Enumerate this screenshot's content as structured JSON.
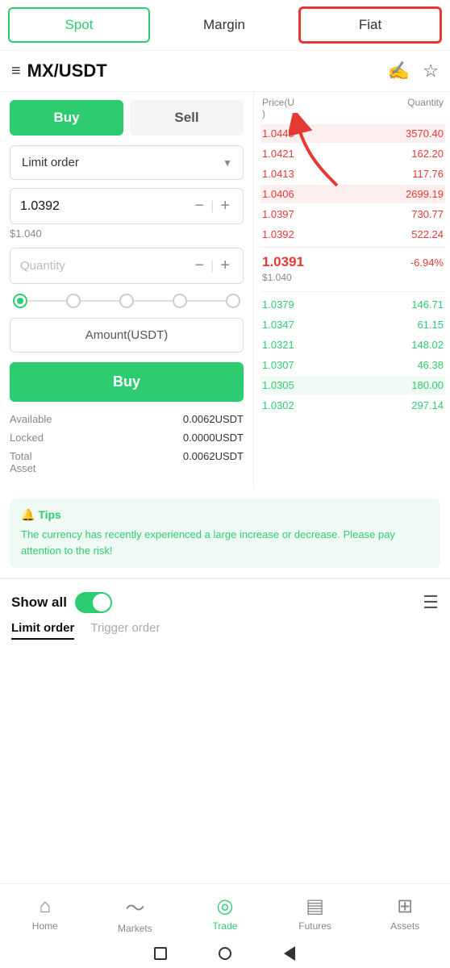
{
  "tabs": {
    "spot": "Spot",
    "margin": "Margin",
    "fiat": "Fiat"
  },
  "header": {
    "pair": "MX/USDT",
    "hamburger": "≡"
  },
  "orderbook": {
    "col_price": "Price(U",
    "col_qty": "Quantity",
    "sell_orders": [
      {
        "price": "1.0440",
        "qty": "3570.40"
      },
      {
        "price": "1.0421",
        "qty": "162.20"
      },
      {
        "price": "1.0413",
        "qty": "117.76"
      },
      {
        "price": "1.0406",
        "qty": "2699.19"
      },
      {
        "price": "1.0397",
        "qty": "730.77"
      },
      {
        "price": "1.0392",
        "qty": "522.24"
      }
    ],
    "mid_price": "1.0391",
    "mid_usd": "$1.040",
    "mid_pct": "-6.94%",
    "buy_orders": [
      {
        "price": "1.0379",
        "qty": "146.71"
      },
      {
        "price": "1.0347",
        "qty": "61.15"
      },
      {
        "price": "1.0321",
        "qty": "148.02"
      },
      {
        "price": "1.0307",
        "qty": "46.38"
      },
      {
        "price": "1.0305",
        "qty": "180.00"
      },
      {
        "price": "1.0302",
        "qty": "297.14"
      }
    ]
  },
  "trade_panel": {
    "buy_label": "Buy",
    "sell_label": "Sell",
    "order_type": "Limit order",
    "price_value": "1.0392",
    "usd_equiv": "$1.040",
    "qty_placeholder": "Quantity",
    "amount_label": "Amount(USDT)",
    "buy_btn": "Buy",
    "available_label": "Available",
    "available_value": "0.0062USDT",
    "locked_label": "Locked",
    "locked_value": "0.0000USDT",
    "total_asset_label": "Total\nAsset",
    "total_asset_value": "0.0062USDT"
  },
  "tips": {
    "title": "🔔 Tips",
    "text": "The currency has recently experienced a large increase or decrease. Please pay attention to the risk!"
  },
  "show_all": {
    "label": "Show all"
  },
  "orders_tabs": {
    "limit": "Limit order",
    "trigger": "Trigger order"
  },
  "bottom_nav": {
    "home": "Home",
    "markets": "Markets",
    "trade": "Trade",
    "futures": "Futures",
    "assets": "Assets"
  }
}
